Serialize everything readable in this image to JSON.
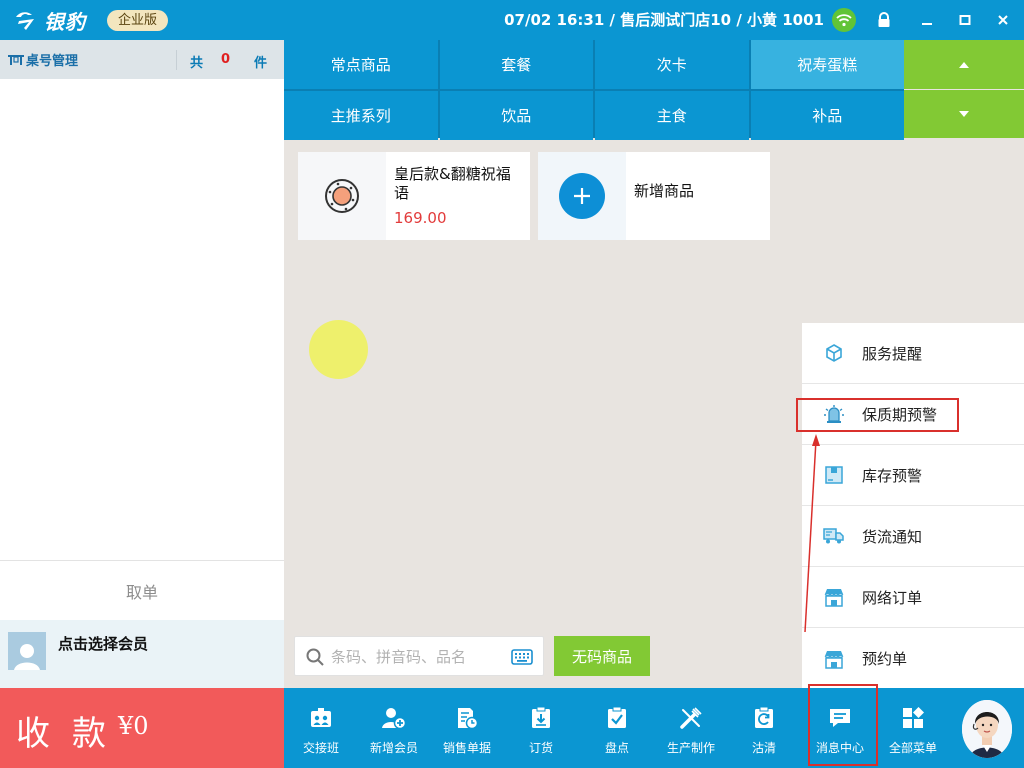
{
  "titlebar": {
    "app_name": "银豹",
    "edition": "企业版",
    "session": "07/02 16:31 / 售后测试门店10 / 小黄 1001",
    "colors": {
      "bar": "#0b96d2",
      "wifi": "#61c437"
    },
    "controls": [
      "lock-icon",
      "minimize-icon",
      "maximize-icon",
      "close-icon"
    ]
  },
  "order": {
    "header_title": "桌号管理",
    "total_prefix": "共",
    "count": "0",
    "unit": "件",
    "cancel_label": "取单",
    "member_label": "点击选择会员",
    "checkout_label": "收款",
    "checkout_amount": "¥0"
  },
  "categories": {
    "items": [
      "常点商品",
      "套餐",
      "次卡",
      "祝寿蛋糕",
      "主推系列",
      "饮品",
      "主食",
      "补品"
    ],
    "active": "祝寿蛋糕"
  },
  "products": [
    {
      "name": "皇后款&翻糖祝福语",
      "price": "169.00",
      "icon": "cookie-icon"
    },
    {
      "name": "新增商品",
      "price": "",
      "icon": "plus-icon"
    }
  ],
  "search": {
    "placeholder": "条码、拼音码、品名",
    "no_code_button": "无码商品"
  },
  "message_menu": {
    "items": [
      {
        "label": "服务提醒",
        "icon": "cube-icon"
      },
      {
        "label": "保质期预警",
        "icon": "siren-icon"
      },
      {
        "label": "库存预警",
        "icon": "inventory-icon"
      },
      {
        "label": "货流通知",
        "icon": "truck-icon"
      },
      {
        "label": "网络订单",
        "icon": "store-icon"
      },
      {
        "label": "预约单",
        "icon": "store-icon"
      }
    ],
    "highlighted": "保质期预警"
  },
  "bottombar": {
    "buttons": [
      {
        "label": "交接班",
        "icon": "handover-icon"
      },
      {
        "label": "新增会员",
        "icon": "add-member-icon"
      },
      {
        "label": "销售单据",
        "icon": "sales-doc-icon"
      },
      {
        "label": "订货",
        "icon": "order-goods-icon"
      },
      {
        "label": "盘点",
        "icon": "stocktake-icon"
      },
      {
        "label": "生产制作",
        "icon": "production-icon"
      },
      {
        "label": "沽清",
        "icon": "sold-out-icon"
      },
      {
        "label": "消息中心",
        "icon": "message-icon"
      },
      {
        "label": "全部菜单",
        "icon": "menu-grid-icon"
      }
    ],
    "highlighted": "消息中心"
  },
  "colors": {
    "accent": "#0b96d2",
    "green": "#82c934",
    "checkout": "#f25a5a",
    "price": "#e23b3b",
    "highlight": "#d9302c"
  }
}
